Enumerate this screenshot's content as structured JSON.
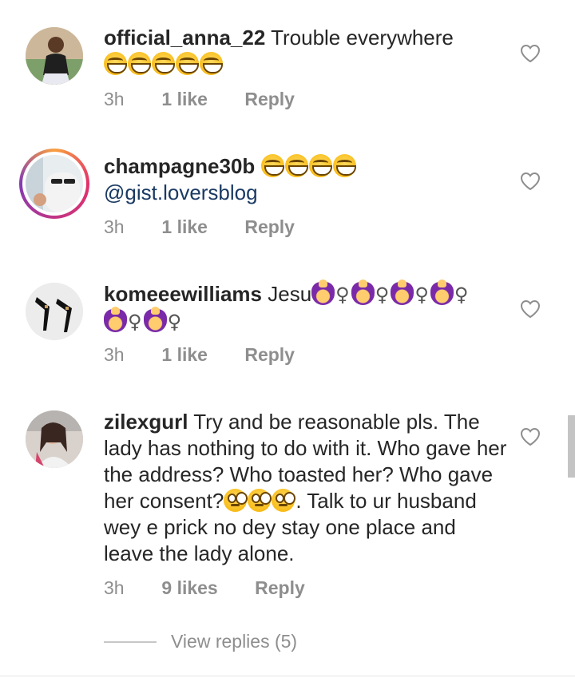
{
  "comments": [
    {
      "username": "official_anna_22",
      "text": "Trouble everywhere",
      "emojis": [
        "grinning-squinting-face",
        "grinning-squinting-face",
        "grinning-squinting-face",
        "grinning-squinting-face",
        "grinning-squinting-face"
      ],
      "time": "3h",
      "likes": "1 like",
      "reply": "Reply"
    },
    {
      "username": "champagne30b",
      "emojis": [
        "grinning-squinting-face",
        "grinning-squinting-face",
        "grinning-squinting-face",
        "grinning-squinting-face"
      ],
      "mention": "@gist.loversblog",
      "time": "3h",
      "likes": "1 like",
      "reply": "Reply",
      "has_story_ring": true
    },
    {
      "username": "komeeewilliams",
      "text": "Jesu",
      "emoji_sign": "♀",
      "emojis": [
        "woman-facepalming",
        "woman-facepalming",
        "woman-facepalming",
        "woman-facepalming",
        "woman-facepalming",
        "woman-facepalming"
      ],
      "time": "3h",
      "likes": "1 like",
      "reply": "Reply"
    },
    {
      "username": "zilexgurl",
      "text_before": "Try and be reasonable pls. The lady has nothing to do with it. Who gave her the address? Who toasted her? Who gave her consent?",
      "emojis": [
        "face-with-rolling-eyes",
        "face-with-rolling-eyes",
        "face-with-rolling-eyes"
      ],
      "text_after": ". Talk to ur husband wey e prick no dey stay one place and leave the lady alone.",
      "time": "3h",
      "likes": "9 likes",
      "reply": "Reply"
    }
  ],
  "view_replies": "View replies (5)",
  "icons": {
    "like": "heart-outline-icon"
  },
  "colors": {
    "mention": "#1a3a63",
    "meta": "#8e8e8e",
    "text": "#262626"
  }
}
